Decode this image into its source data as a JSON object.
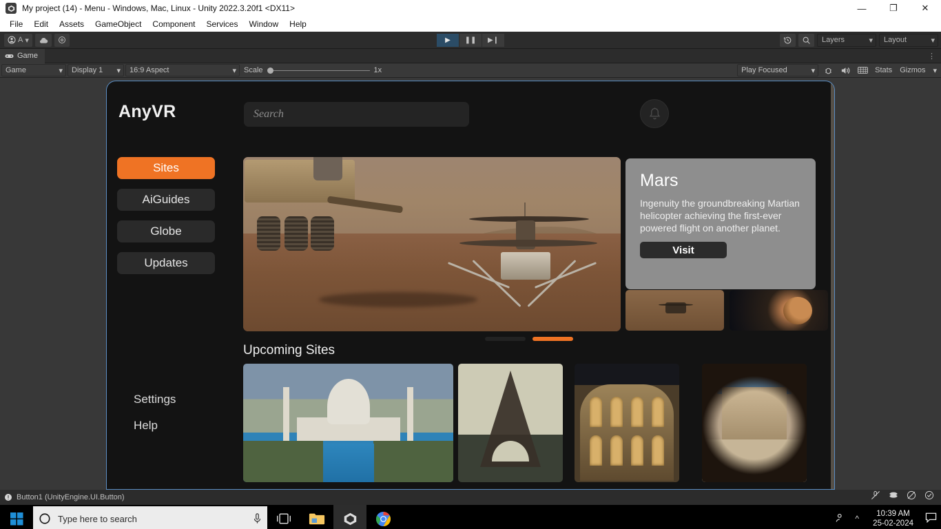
{
  "window": {
    "title": "My project (14) - Menu - Windows, Mac, Linux - Unity 2022.3.20f1 <DX11>",
    "app_icon": "unity-icon",
    "minimize": "—",
    "maximize": "❐",
    "close": "✕"
  },
  "menubar": {
    "items": [
      "File",
      "Edit",
      "Assets",
      "GameObject",
      "Component",
      "Services",
      "Window",
      "Help"
    ]
  },
  "toolbar": {
    "account_label": "A",
    "account_icon": "account-icon",
    "cloud_icon": "cloud-icon",
    "settings_icon": "cog-icon",
    "play_icon": "▶",
    "pause_icon": "❚❚",
    "step_icon": "▶❙",
    "history_icon": "undo-history-icon",
    "search_icon": "search-icon",
    "layers_label": "Layers",
    "layout_label": "Layout",
    "dropdown_caret": "▾"
  },
  "tabbar": {
    "tab_label": "Game",
    "tab_icon": "gamepad-icon",
    "overflow_icon": "⋮"
  },
  "gamebar": {
    "view_selector": "Game",
    "display": "Display 1",
    "aspect": "16:9 Aspect",
    "scale_label": "Scale",
    "scale_value": "1x",
    "play_mode": "Play Focused",
    "bug_icon": "bug-icon",
    "mute_icon": "speaker-icon",
    "stats_grid_icon": "grid-icon",
    "stats_label": "Stats",
    "gizmos_label": "Gizmos",
    "caret": "▾"
  },
  "vrapp": {
    "logo": "AnyVR",
    "search_placeholder": "Search",
    "notification_icon": "bell-icon",
    "nav_items": [
      {
        "label": "Sites",
        "active": true
      },
      {
        "label": "AiGuides",
        "active": false
      },
      {
        "label": "Globe",
        "active": false
      },
      {
        "label": "Updates",
        "active": false
      }
    ],
    "footer_links": [
      "Settings",
      "Help"
    ],
    "hero": {
      "alt": "mars-rover-ingenuity-helicopter-image"
    },
    "card": {
      "title": "Mars",
      "description": "Ingenuity the groundbreaking Martian helicopter achieving the first-ever powered flight on another planet.",
      "button_label": "Visit"
    },
    "thumbnails": [
      {
        "alt": "mars-helicopter-surface-thumb"
      },
      {
        "alt": "mars-planet-space-thumb"
      }
    ],
    "carousel": {
      "total": 2,
      "active_index": 1
    },
    "upcoming": {
      "title": "Upcoming Sites",
      "sites": [
        {
          "alt": "taj-mahal-image"
        },
        {
          "alt": "eiffel-tower-image"
        },
        {
          "alt": "colosseum-image"
        },
        {
          "alt": "petra-treasury-image"
        }
      ]
    },
    "accent_color": "#ef7324",
    "panel_border_color": "#5b8ec4"
  },
  "statusbar": {
    "message": "Button1 (UnityEngine.UI.Button)",
    "icon": "warning-icon"
  },
  "taskbar": {
    "start_icon": "windows-start-icon",
    "search_placeholder": "Type here to search",
    "cortana_icon": "cortana-circle-icon",
    "mic_icon": "microphone-icon",
    "taskview_icon": "task-view-icon",
    "apps": [
      {
        "name": "file-explorer",
        "icon": "folder-icon"
      },
      {
        "name": "unity-hub",
        "icon": "unity-icon"
      },
      {
        "name": "google-chrome",
        "icon": "chrome-icon"
      }
    ],
    "tray": {
      "people_icon": "people-icon",
      "chevron_icon": "^",
      "time": "10:39 AM",
      "date": "25-02-2024",
      "notification_icon": "notification-icon"
    },
    "sys_icons": [
      "mic-muted-icon",
      "network-icon",
      "volume-muted-icon",
      "check-circle-icon"
    ]
  }
}
